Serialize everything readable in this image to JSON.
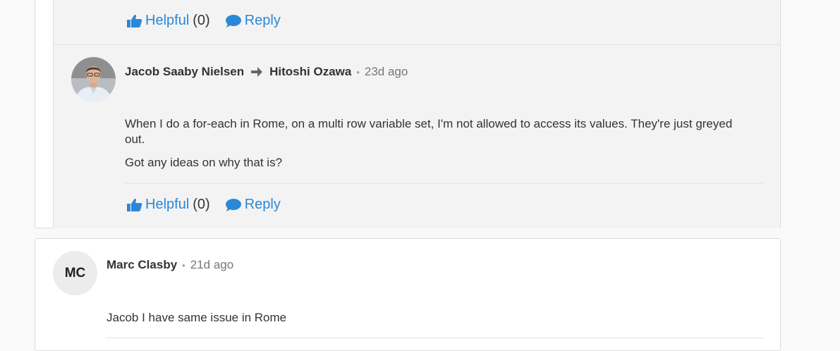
{
  "actions_top": {
    "helpful_label": "Helpful",
    "helpful_count": "(0)",
    "reply_label": "Reply"
  },
  "reply_comment": {
    "author": "Jacob Saaby Nielsen",
    "recipient": "Hitoshi Ozawa",
    "time": "23d ago",
    "paragraphs": [
      "When I do a for-each in Rome, on a multi row variable set, I'm not allowed to access its values. They're just greyed out.",
      "Got any ideas on why that is?"
    ],
    "helpful_label": "Helpful",
    "helpful_count": "(0)",
    "reply_label": "Reply"
  },
  "comment2": {
    "initials": "MC",
    "author": "Marc Clasby",
    "time": "21d ago",
    "text": "Jacob I have same issue in Rome"
  },
  "colors": {
    "link": "#2b88d9",
    "nested_bg": "#f3f3f3",
    "page_bg": "#f9f9f9"
  }
}
